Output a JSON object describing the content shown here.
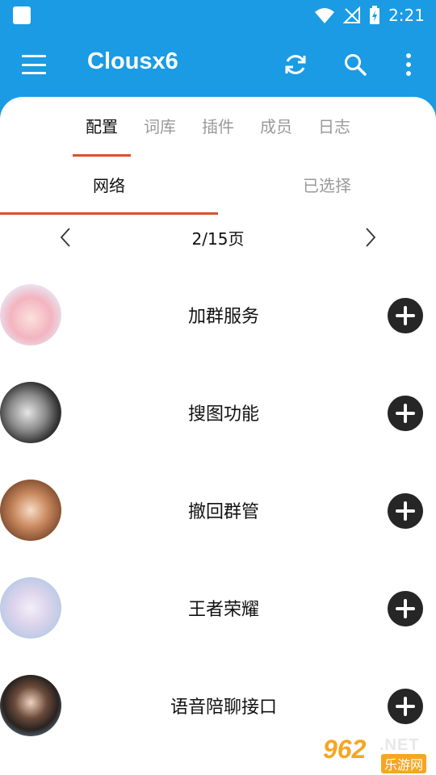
{
  "status_bar": {
    "time": "2:21"
  },
  "app_bar": {
    "title": "Clousx6",
    "icons": [
      "menu-icon",
      "refresh-icon",
      "search-icon",
      "more-vert-icon"
    ]
  },
  "top_tabs": [
    {
      "label": "配置",
      "active": true
    },
    {
      "label": "词库",
      "active": false
    },
    {
      "label": "插件",
      "active": false
    },
    {
      "label": "成员",
      "active": false
    },
    {
      "label": "日志",
      "active": false
    }
  ],
  "sub_tabs": [
    {
      "label": "网络",
      "active": true
    },
    {
      "label": "已选择",
      "active": false
    }
  ],
  "pager": {
    "text": "2/15页"
  },
  "items": [
    {
      "label": "加群服务"
    },
    {
      "label": "搜图功能"
    },
    {
      "label": "撤回群管"
    },
    {
      "label": "王者荣耀"
    },
    {
      "label": "语音陪聊接口"
    }
  ],
  "watermark": {
    "num": "962",
    "net": ".NET",
    "cn": "乐游网"
  },
  "colors": {
    "primary": "#1a9be3",
    "accent": "#d9532b",
    "button": "#262626"
  }
}
